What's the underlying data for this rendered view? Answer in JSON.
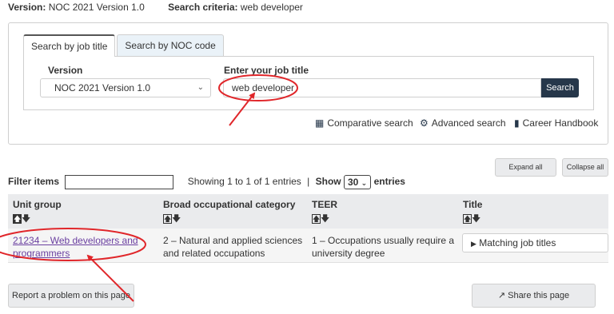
{
  "criteria": {
    "version_label": "Version:",
    "version_value": "NOC 2021 Version 1.0",
    "search_label": "Search criteria:",
    "search_value": "web developer"
  },
  "tabs": [
    {
      "label": "Search by job title",
      "active": true
    },
    {
      "label": "Search by NOC code",
      "active": false
    }
  ],
  "search": {
    "version_label": "Version",
    "version_selected": "NOC 2021 Version 1.0",
    "title_label": "Enter your job title",
    "title_value": "web developer",
    "search_button": "Search"
  },
  "links": {
    "comparative": "Comparative search",
    "advanced": "Advanced search",
    "handbook": "Career Handbook"
  },
  "controls": {
    "expand_all": "Expand all",
    "collapse_all": "Collapse all"
  },
  "filter": {
    "label": "Filter items",
    "value": "",
    "showing": "Showing 1 to 1 of 1 entries",
    "separator": "|",
    "show_label": "Show",
    "show_value": "30",
    "entries_label": "entries"
  },
  "table": {
    "headers": [
      "Unit group",
      "Broad occupational category",
      "TEER",
      "Title"
    ],
    "row": {
      "unit_group_line1": "21234 – Web developers and",
      "unit_group_line2": "programmers",
      "broad_line1": "2 – Natural and applied sciences",
      "broad_line2": "and related occupations",
      "teer_line1": "1 – Occupations usually require a",
      "teer_line2": "university degree",
      "title_button": "Matching job titles"
    }
  },
  "footer": {
    "report": "Report a problem on this page",
    "share": "Share this page"
  },
  "colors": {
    "annotation": "#e0262a",
    "primary_button": "#26374a",
    "link_visited": "#6a3fa0"
  }
}
